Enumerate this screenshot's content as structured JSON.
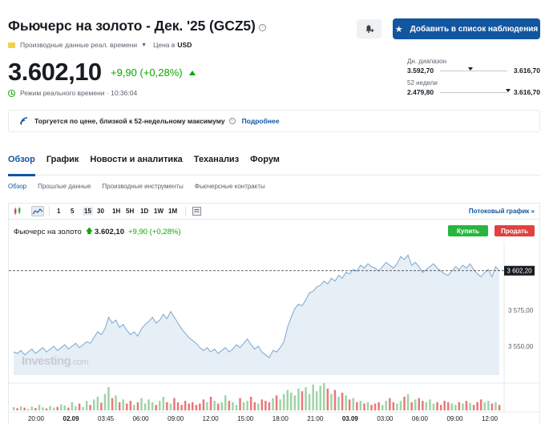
{
  "header": {
    "title": "Фьючерс на золото - Дек. '25 (GCZ5)",
    "data_type": "Производные данные реал. времени",
    "currency_label": "Цена в",
    "currency": "USD",
    "watchlist_button": "Добавить в список наблюдения",
    "alert_icon": "bell-plus-icon"
  },
  "quote": {
    "price": "3.602,10",
    "change": "+9,90 (+0,28%)",
    "status": "Режим реального времени · 10:36:04"
  },
  "ranges": {
    "day": {
      "label": "Дн. диапазон",
      "low": "3.592,70",
      "high": "3.616,70",
      "position": 0.42
    },
    "week52": {
      "label": "52 недели",
      "low": "2.479,80",
      "high": "3.616,70",
      "position": 0.98
    }
  },
  "alert": {
    "text": "Торгуется по цене, близкой к 52-недельному максимуму",
    "link": "Подробнее"
  },
  "tabs": [
    "Обзор",
    "График",
    "Новости и аналитика",
    "Теханализ",
    "Форум"
  ],
  "subtabs": [
    "Обзор",
    "Прошлые данные",
    "Производные инструменты",
    "Фьючерсные контракты"
  ],
  "chart_toolbar": {
    "timeframes": [
      "1",
      "5",
      "15",
      "30",
      "1H",
      "5H",
      "1D",
      "1W",
      "1M"
    ],
    "selected": "15",
    "advanced_link": "Потоковый график"
  },
  "chart_header": {
    "name": "Фьючерс на золото",
    "price": "3.602,10",
    "change": "+9,90 (+0,28%)",
    "buy": "Купить",
    "sell": "Продать"
  },
  "watermark": {
    "brand": "Investing",
    "suffix": ".com"
  },
  "chart_data": {
    "type": "area",
    "y_ticks": [
      3575,
      3550
    ],
    "y_tick_labels": [
      "3 575,00",
      "3 550,00"
    ],
    "last_price_label": "3 602,20",
    "last_price": 3602.2,
    "x_tick_labels": [
      "20:00",
      "02.09",
      "03:45",
      "06:00",
      "09:00",
      "12:00",
      "15:00",
      "18:00",
      "21:00",
      "03.09",
      "03:00",
      "06:00",
      "09:00",
      "12:00"
    ],
    "x_tick_bold": [
      false,
      true,
      false,
      false,
      false,
      false,
      false,
      false,
      false,
      true,
      false,
      false,
      false,
      false
    ],
    "values": [
      3546,
      3545,
      3547,
      3544,
      3546,
      3548,
      3545,
      3547,
      3549,
      3546,
      3548,
      3550,
      3547,
      3549,
      3551,
      3548,
      3550,
      3552,
      3549,
      3551,
      3553,
      3552,
      3556,
      3560,
      3558,
      3562,
      3570,
      3566,
      3568,
      3563,
      3565,
      3561,
      3558,
      3560,
      3557,
      3562,
      3565,
      3567,
      3570,
      3566,
      3568,
      3572,
      3569,
      3574,
      3570,
      3566,
      3562,
      3559,
      3556,
      3554,
      3552,
      3549,
      3547,
      3549,
      3546,
      3548,
      3545,
      3547,
      3549,
      3546,
      3548,
      3551,
      3549,
      3552,
      3555,
      3551,
      3548,
      3550,
      3546,
      3544,
      3542,
      3547,
      3546,
      3549,
      3553,
      3563,
      3570,
      3576,
      3579,
      3578,
      3582,
      3587,
      3588,
      3591,
      3592,
      3595,
      3593,
      3597,
      3595,
      3599,
      3597,
      3601,
      3600,
      3603,
      3602,
      3606,
      3604,
      3607,
      3605,
      3604,
      3602,
      3605,
      3608,
      3606,
      3604,
      3607,
      3612,
      3610,
      3613,
      3606,
      3608,
      3605,
      3601,
      3603,
      3605,
      3607,
      3604,
      3602,
      3600,
      3599,
      3602,
      3605,
      3603,
      3606,
      3604,
      3607,
      3603,
      3600,
      3598,
      3601,
      3603,
      3598,
      3605,
      3602
    ],
    "volumes": [
      0.12,
      0.08,
      0.15,
      0.1,
      0.06,
      0.14,
      0.09,
      0.2,
      0.11,
      0.07,
      0.16,
      0.1,
      0.13,
      0.22,
      0.18,
      0.1,
      0.3,
      0.15,
      0.25,
      0.12,
      0.35,
      0.2,
      0.4,
      0.5,
      0.28,
      0.6,
      0.85,
      0.45,
      0.55,
      0.3,
      0.4,
      0.25,
      0.35,
      0.2,
      0.3,
      0.45,
      0.25,
      0.4,
      0.3,
      0.2,
      0.35,
      0.5,
      0.3,
      0.25,
      0.45,
      0.3,
      0.2,
      0.35,
      0.25,
      0.3,
      0.2,
      0.25,
      0.4,
      0.3,
      0.5,
      0.35,
      0.25,
      0.3,
      0.55,
      0.35,
      0.3,
      0.2,
      0.45,
      0.3,
      0.35,
      0.5,
      0.3,
      0.25,
      0.4,
      0.35,
      0.3,
      0.45,
      0.55,
      0.4,
      0.6,
      0.75,
      0.65,
      0.55,
      0.8,
      0.7,
      0.85,
      0.6,
      0.95,
      0.7,
      0.9,
      1.0,
      0.8,
      0.6,
      0.75,
      0.5,
      0.65,
      0.55,
      0.4,
      0.45,
      0.3,
      0.35,
      0.25,
      0.3,
      0.2,
      0.25,
      0.3,
      0.2,
      0.35,
      0.45,
      0.3,
      0.25,
      0.35,
      0.5,
      0.6,
      0.3,
      0.4,
      0.45,
      0.35,
      0.3,
      0.4,
      0.25,
      0.3,
      0.2,
      0.35,
      0.3,
      0.25,
      0.2,
      0.3,
      0.25,
      0.35,
      0.28,
      0.2,
      0.3,
      0.4,
      0.3,
      0.35,
      0.25,
      0.3,
      0.2
    ],
    "colors": {
      "line": "#7ea8cf",
      "fill": "#e6eef6",
      "up": "#9ed4a6",
      "down": "#e8787a",
      "dash": "#333333"
    }
  }
}
